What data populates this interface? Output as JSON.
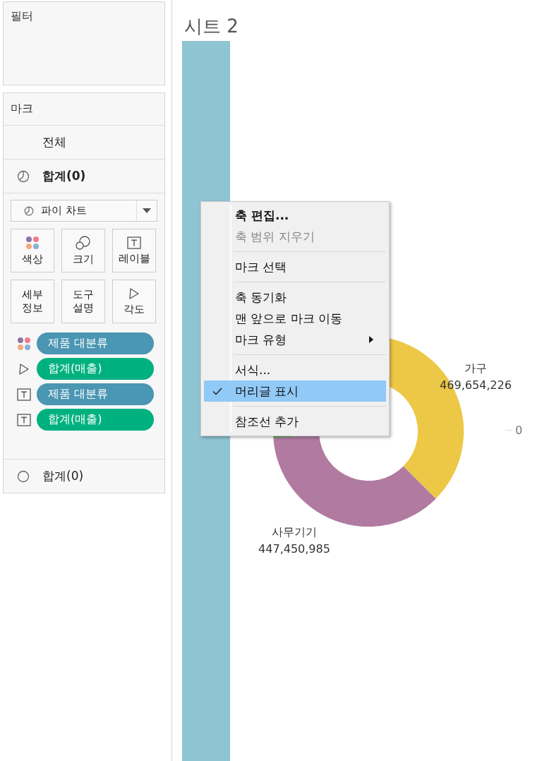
{
  "filters": {
    "title": "필터"
  },
  "marks": {
    "title": "마크",
    "cards": [
      {
        "label": "전체",
        "kind": "all",
        "expanded": false
      },
      {
        "label": "합계(0)",
        "kind": "pie",
        "expanded": true
      }
    ],
    "mark_type": {
      "label": "파이 차트",
      "kind": "pie"
    },
    "buttons": [
      {
        "label": "색상",
        "kind": "color"
      },
      {
        "label": "크기",
        "kind": "size"
      },
      {
        "label": "레이블",
        "kind": "label"
      },
      {
        "label": "세부\n정보",
        "kind": "none"
      },
      {
        "label": "도구\n설명",
        "kind": "none"
      },
      {
        "label": "각도",
        "kind": "angle"
      }
    ],
    "pills": [
      {
        "label": "제품 대분류",
        "kind": "color",
        "color": "#4a96b3"
      },
      {
        "label": "합계(매출)",
        "kind": "angle",
        "color": "#00b180"
      },
      {
        "label": "제품 대분류",
        "kind": "label",
        "color": "#4a96b3"
      },
      {
        "label": "합계(매출)",
        "kind": "label",
        "color": "#00b180"
      }
    ],
    "bottom_card": {
      "label": "합계(0)",
      "kind": "circle",
      "expanded": false
    }
  },
  "sheet": {
    "title": "시트 2",
    "labels": [
      {
        "name": "가구",
        "value": "469,654,226",
        "kind": "right"
      },
      {
        "name": "사무기기",
        "value": "447,450,985",
        "kind": "bottom"
      }
    ],
    "axis_label": "0"
  },
  "context_menu": {
    "groups": [
      [
        {
          "label": "축 편집...",
          "default": true,
          "disabled": false,
          "checked": false,
          "selected": false,
          "submenu": false
        },
        {
          "label": "축 범위 지우기",
          "default": false,
          "disabled": true,
          "checked": false,
          "selected": false,
          "submenu": false
        }
      ],
      [
        {
          "label": "마크 선택",
          "default": false,
          "disabled": false,
          "checked": false,
          "selected": false,
          "submenu": false
        }
      ],
      [
        {
          "label": "축 동기화",
          "default": false,
          "disabled": false,
          "checked": false,
          "selected": false,
          "submenu": false
        },
        {
          "label": "맨 앞으로 마크 이동",
          "default": false,
          "disabled": false,
          "checked": false,
          "selected": false,
          "submenu": false
        },
        {
          "label": "마크 유형",
          "default": false,
          "disabled": false,
          "checked": false,
          "selected": false,
          "submenu": true
        }
      ],
      [
        {
          "label": "서식...",
          "default": false,
          "disabled": false,
          "checked": false,
          "selected": false,
          "submenu": false
        },
        {
          "label": "머리글 표시",
          "default": false,
          "disabled": false,
          "checked": true,
          "selected": true,
          "submenu": false
        }
      ],
      [
        {
          "label": "참조선 추가",
          "default": false,
          "disabled": false,
          "checked": false,
          "selected": false,
          "submenu": false
        }
      ]
    ]
  }
}
